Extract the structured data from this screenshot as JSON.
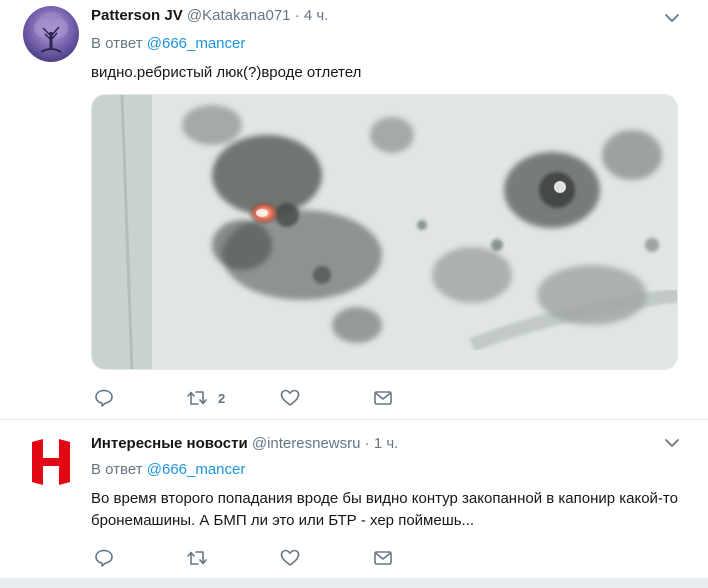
{
  "tweets": [
    {
      "name": "Patterson JV",
      "handle": "@Katakana071",
      "dot": "·",
      "time": "4 ч.",
      "reply_prefix": "В ответ",
      "reply_mention": "@666_mancer",
      "text": "видно.ребристый люк(?)вроде отлетел",
      "actions": {
        "reply_count": "",
        "retweet_count": "2",
        "like_count": ""
      }
    },
    {
      "name": "Интересные новости",
      "handle": "@interesnewsru",
      "dot": "·",
      "time": "1 ч.",
      "reply_prefix": "В ответ",
      "reply_mention": "@666_mancer",
      "text": "Во время второго попадания вроде бы видно контур закопанной в капонир какой-то бронемашины. А БМП ли это или БТР - хер поймешь...",
      "actions": {
        "reply_count": "",
        "retweet_count": "",
        "like_count": ""
      }
    }
  ],
  "colors": {
    "text_primary": "#14171a",
    "text_secondary": "#657786",
    "link": "#1b95e0",
    "logo_red": "#e30613",
    "separator": "#e6ecf0"
  },
  "icons": [
    "chevron-down-icon",
    "reply-icon",
    "retweet-icon",
    "like-icon",
    "direct-message-icon"
  ]
}
